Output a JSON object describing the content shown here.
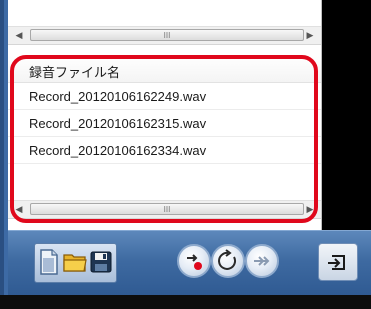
{
  "list": {
    "header": "録音ファイル名",
    "rows": [
      "Record_20120106162249.wav",
      "Record_20120106162315.wav",
      "Record_20120106162334.wav"
    ]
  },
  "scrollbar": {
    "grip_glyph": "III",
    "left_arrow": "◀",
    "right_arrow": "▶"
  },
  "toolbar": {
    "file_buttons": [
      "document-icon",
      "folder-icon",
      "save-icon"
    ],
    "playback_buttons": [
      "record-play-icon",
      "refresh-icon",
      "fast-forward-icon"
    ],
    "exit_button": "exit-icon"
  },
  "colors": {
    "highlight": "#e0081c",
    "toolbar": "#3e6aa1",
    "record_dot": "#e0081c"
  }
}
